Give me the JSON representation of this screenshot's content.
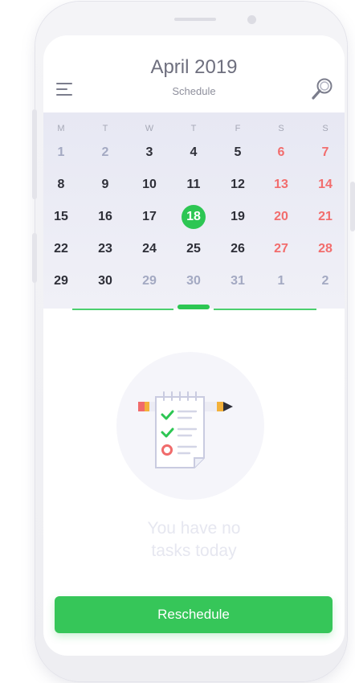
{
  "header": {
    "title": "April 2019",
    "subtitle": "Schedule"
  },
  "calendar": {
    "weekdays": [
      "M",
      "T",
      "W",
      "T",
      "F",
      "S",
      "S"
    ],
    "weeks": [
      [
        {
          "d": "1",
          "s": "muted"
        },
        {
          "d": "2",
          "s": "muted"
        },
        {
          "d": "3",
          "s": "normal"
        },
        {
          "d": "4",
          "s": "normal"
        },
        {
          "d": "5",
          "s": "normal"
        },
        {
          "d": "6",
          "s": "weekend"
        },
        {
          "d": "7",
          "s": "weekend"
        }
      ],
      [
        {
          "d": "8",
          "s": "normal"
        },
        {
          "d": "9",
          "s": "normal"
        },
        {
          "d": "10",
          "s": "normal"
        },
        {
          "d": "11",
          "s": "normal"
        },
        {
          "d": "12",
          "s": "normal"
        },
        {
          "d": "13",
          "s": "weekend"
        },
        {
          "d": "14",
          "s": "weekend"
        }
      ],
      [
        {
          "d": "15",
          "s": "normal"
        },
        {
          "d": "16",
          "s": "normal"
        },
        {
          "d": "17",
          "s": "normal"
        },
        {
          "d": "18",
          "s": "today"
        },
        {
          "d": "19",
          "s": "normal"
        },
        {
          "d": "20",
          "s": "weekend"
        },
        {
          "d": "21",
          "s": "weekend"
        }
      ],
      [
        {
          "d": "22",
          "s": "normal"
        },
        {
          "d": "23",
          "s": "normal"
        },
        {
          "d": "24",
          "s": "normal"
        },
        {
          "d": "25",
          "s": "normal"
        },
        {
          "d": "26",
          "s": "normal"
        },
        {
          "d": "27",
          "s": "weekend"
        },
        {
          "d": "28",
          "s": "weekend"
        }
      ],
      [
        {
          "d": "29",
          "s": "normal"
        },
        {
          "d": "30",
          "s": "normal"
        },
        {
          "d": "29",
          "s": "muted"
        },
        {
          "d": "30",
          "s": "muted"
        },
        {
          "d": "31",
          "s": "muted"
        },
        {
          "d": "1",
          "s": "muted"
        },
        {
          "d": "2",
          "s": "muted"
        }
      ]
    ]
  },
  "empty_state": {
    "line1": "You have no",
    "line2": "tasks today",
    "icon": "checklist-icon"
  },
  "actions": {
    "reschedule_label": "Reschedule"
  },
  "icons": {
    "menu": "menu-icon",
    "search": "search-icon"
  },
  "colors": {
    "accent": "#36c659",
    "weekend": "#f26d6d",
    "muted_day": "#a3a9c2"
  }
}
